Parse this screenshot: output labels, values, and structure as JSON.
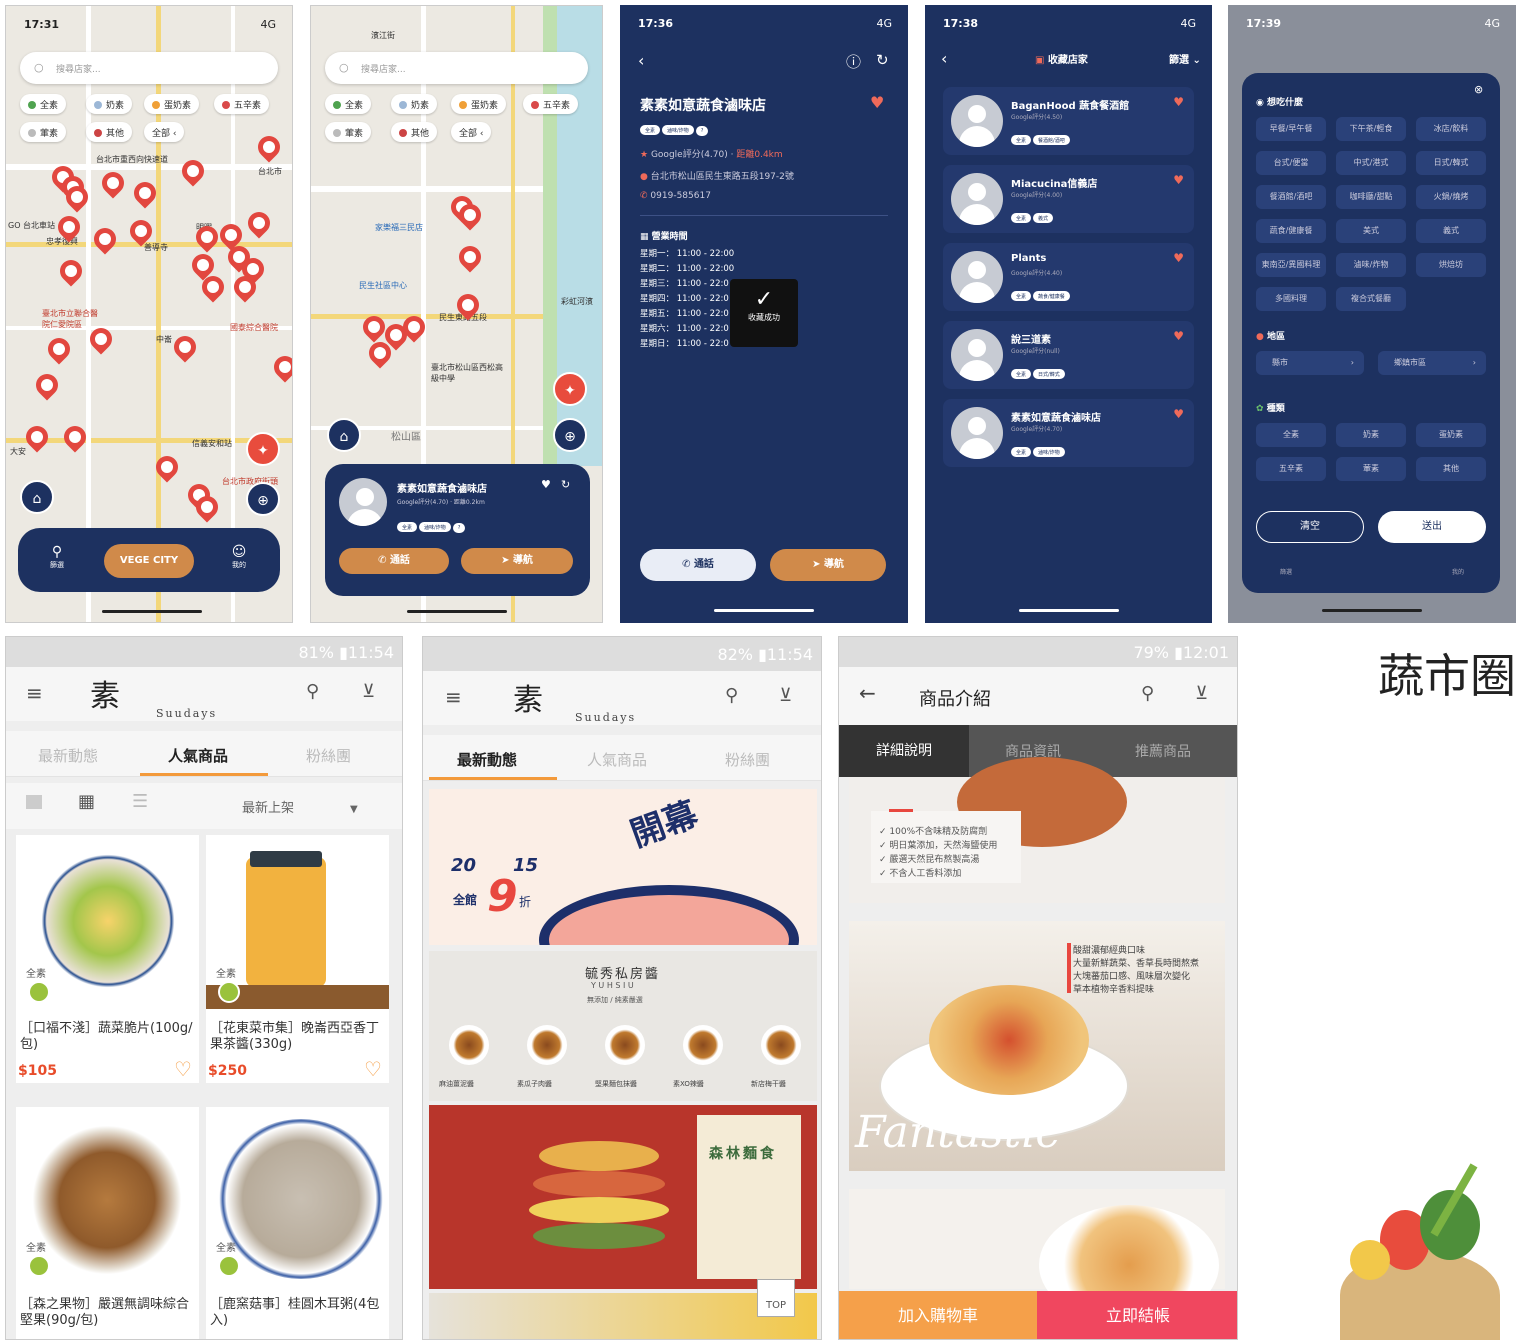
{
  "screens": {
    "s1": {
      "time": "17:31",
      "signal": "4G",
      "search_placeholder": "搜尋店家...",
      "chips": [
        "全素",
        "奶素",
        "蛋奶素",
        "五辛素",
        "葷素",
        "其他",
        "全部"
      ],
      "map_labels": [
        "台北市重西向快速道",
        "台北市",
        "GO 台北車站",
        "忠孝復興",
        "善導寺",
        "明曜",
        "忠孝新生",
        "臺北市立聯合醫院仁愛院區",
        "中崙",
        "國泰綜合醫院",
        "信義安和站",
        "台北市政府街頭",
        "大安"
      ],
      "center_button": "VEGE CITY",
      "filter_label": "篩選",
      "me_label": "我的"
    },
    "s2": {
      "search_placeholder": "搜尋店家...",
      "chips": [
        "全素",
        "奶素",
        "蛋奶素",
        "五辛素",
        "葷素",
        "其他",
        "全部"
      ],
      "map_labels": [
        "濱江街",
        "家樂福三民店",
        "民生社區中心",
        "民生東路五段",
        "臺北市松山區西松高級中學",
        "松山區",
        "彩虹河濱"
      ],
      "store_name": "素素如意蔬食滷味店",
      "store_sub": "Google評分(4.70) · 距離0.2km",
      "tags": [
        "全素",
        "滷味/炸物",
        "?"
      ],
      "call": "通話",
      "nav": "導航"
    },
    "s3": {
      "time": "17:36",
      "signal": "4G",
      "title": "素素如意蔬食滷味店",
      "tags": [
        "全素",
        "滷味/炸物",
        "?"
      ],
      "rating": "Google評分(4.70)",
      "distance": "距離0.4km",
      "address": "台北市松山區民生東路五段197-2號",
      "phone": "0919-585617",
      "hours_title": "營業時間",
      "hours": [
        "星期一： 11:00 - 22:00",
        "星期二： 11:00 - 22:00",
        "星期三： 11:00 - 22:0",
        "星期四： 11:00 - 22:0",
        "星期五： 11:00 - 22:0",
        "星期六： 11:00 - 22:0",
        "星期日： 11:00 - 22:0"
      ],
      "toast": "收藏成功",
      "call": "通話",
      "nav": "導航"
    },
    "s4": {
      "time": "17:38",
      "signal": "4G",
      "title": "收藏店家",
      "filter": "篩選",
      "items": [
        {
          "name": "BaganHood 蔬食餐酒館",
          "rating": "Google評分(4.50)",
          "tags": [
            "全素",
            "餐酒館/酒吧"
          ]
        },
        {
          "name": "Miacucina信義店",
          "rating": "Google評分(4.00)",
          "tags": [
            "全素",
            "義式"
          ]
        },
        {
          "name": "Plants",
          "rating": "Google評分(4.40)",
          "tags": [
            "全素",
            "蔬食/健康餐"
          ]
        },
        {
          "name": "說三道素",
          "rating": "Google評分(null)",
          "tags": [
            "全素",
            "日式/韓式"
          ]
        },
        {
          "name": "素素如意蔬食滷味店",
          "rating": "Google評分(4.70)",
          "tags": [
            "全素",
            "滷味/炸物"
          ]
        }
      ]
    },
    "s5": {
      "time": "17:39",
      "signal": "4G",
      "sec1": "想吃什麼",
      "foods": [
        "早餐/早午餐",
        "下午茶/輕食",
        "冰店/飲料",
        "台式/便當",
        "中式/港式",
        "日式/韓式",
        "餐酒館/酒吧",
        "咖啡廳/甜點",
        "火鍋/燒烤",
        "蔬食/健康餐",
        "美式",
        "義式",
        "東南亞/異國料理",
        "滷味/炸物",
        "烘焙坊",
        "多國料理",
        "複合式餐廳"
      ],
      "sec2": "地區",
      "county": "縣市",
      "district": "鄉鎮市區",
      "sec3": "種類",
      "kinds": [
        "全素",
        "奶素",
        "蛋奶素",
        "五辛素",
        "葷素",
        "其他"
      ],
      "clear": "清空",
      "submit": "送出",
      "bar_left": "篩選",
      "bar_right": "我的"
    },
    "s6": {
      "status": "81%",
      "time": "11:54",
      "brand": "Suudays",
      "tabs": [
        "最新動態",
        "人氣商品",
        "粉絲團"
      ],
      "sort": "最新上架",
      "products": [
        {
          "tag": "全素",
          "title": "［口福不淺］蔬菜脆片(100g/包)",
          "price": "$105"
        },
        {
          "tag": "全素",
          "title": "［花東菜市集］晚崙西亞香丁果茶醬(330g)",
          "price": "$250"
        },
        {
          "tag": "全素",
          "title": "［森之果物］嚴選無調味綜合堅果(90g/包)",
          "price": ""
        },
        {
          "tag": "全素",
          "title": "［鹿窯菇事］桂圓木耳粥(4包入)",
          "price": ""
        }
      ]
    },
    "s7": {
      "status": "82%",
      "time": "11:54",
      "brand": "Suudays",
      "tabs": [
        "最新動態",
        "人氣商品",
        "粉絲團"
      ],
      "banner_num1": "20",
      "banner_num2": "15",
      "banner_text": "全館",
      "banner_big": "9",
      "banner_suffix": "折",
      "banner_kanji": "開幕",
      "sauce_title": "毓秀私房醬",
      "sauce_sub": "Y U H S I U",
      "sauce_tag": "無添加 / 純素嚴選",
      "sauces": [
        "麻油薑泥醬",
        "素瓜子肉醬",
        "堅果麵包抹醬",
        "素XO辣醬",
        "新店梅干醬"
      ],
      "noodle_title": "森林麵食",
      "top": "TOP"
    },
    "s8": {
      "status": "79%",
      "time": "12:01",
      "title": "商品介紹",
      "tabs": [
        "詳細說明",
        "商品資訊",
        "推薦商品"
      ],
      "features": [
        "100%不含味精及防腐劑",
        "明日葉添加，天然海鹽使用",
        "嚴選天然昆布熬製高湯",
        "不含人工香料添加"
      ],
      "desc": [
        "酸甜濃郁經典口味",
        "大量新鮮蔬菜、香草長時間熬煮",
        "大塊蕃茄口感、風味層次變化",
        "草本植物辛香料提味"
      ],
      "script": "Fantastic",
      "cart": "加入購物車",
      "buy": "立即結帳"
    }
  },
  "logo_text": "蔬市圈",
  "colors": {
    "navy": "#1d3160",
    "orange": "#d08a4a",
    "red_pin": "#e2473f",
    "cart_orange": "#f5a04a",
    "buy_pink": "#f0475f"
  }
}
